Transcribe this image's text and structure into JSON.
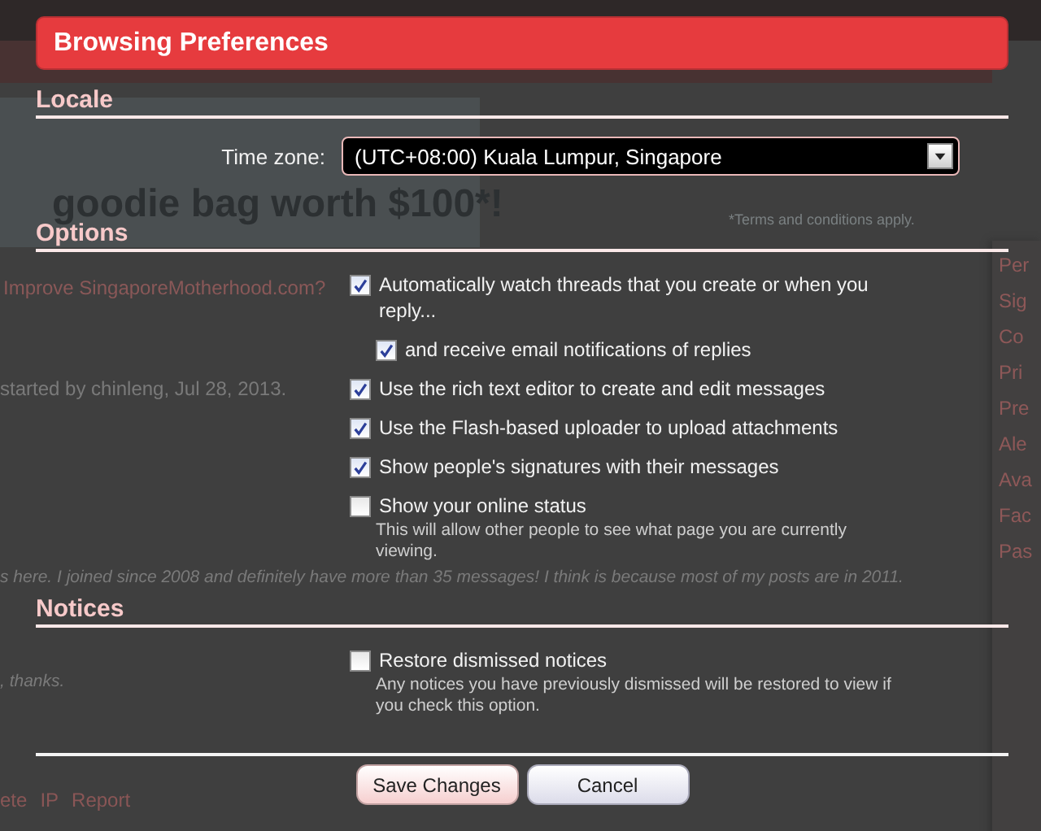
{
  "background": {
    "banner": {
      "headline_2": "goodie bag worth $100*!",
      "note": "*Terms and conditions apply."
    },
    "thread_title": "Improve SingaporeMotherhood.com?",
    "thread_meta": "started by chinleng, Jul 28, 2013.",
    "post_lines": [
      "s here. I joined since 2008 and definitely have more than 35 messages! I think is because most of my posts are in 2011.",
      ", thanks."
    ],
    "post_links": [
      "ete",
      "IP",
      "Report"
    ],
    "sidebar_items": [
      "Per",
      "Sig",
      "Co",
      "Pri",
      "Pre",
      "Ale",
      "Ava",
      "Fac",
      "Pas"
    ]
  },
  "dialog": {
    "title": "Browsing Preferences",
    "sections": [
      {
        "heading": "Locale",
        "fields": [
          {
            "kind": "select",
            "label": "Time zone:",
            "value": "(UTC+08:00) Kuala Lumpur, Singapore"
          }
        ]
      },
      {
        "heading": "Options",
        "fields": [
          {
            "kind": "checkbox",
            "label": "Automatically watch threads that you create or when you reply...",
            "checked": true,
            "children": [
              {
                "kind": "checkbox",
                "label": "and receive email notifications of replies",
                "checked": true
              }
            ]
          },
          {
            "kind": "checkbox",
            "label": "Use the rich text editor to create and edit messages",
            "checked": true
          },
          {
            "kind": "checkbox",
            "label": "Use the Flash-based uploader to upload attachments",
            "checked": true
          },
          {
            "kind": "checkbox",
            "label": "Show people's signatures with their messages",
            "checked": true
          },
          {
            "kind": "checkbox",
            "label": "Show your online status",
            "checked": false,
            "hint": "This will allow other people to see what page you are currently viewing."
          }
        ]
      },
      {
        "heading": "Notices",
        "fields": [
          {
            "kind": "checkbox",
            "label": "Restore dismissed notices",
            "checked": false,
            "hint": "Any notices you have previously dismissed will be restored to view if you check this option."
          }
        ]
      }
    ],
    "buttons": [
      {
        "label": "Save Changes",
        "kind": "primary"
      },
      {
        "label": "Cancel",
        "kind": "secondary"
      }
    ]
  }
}
